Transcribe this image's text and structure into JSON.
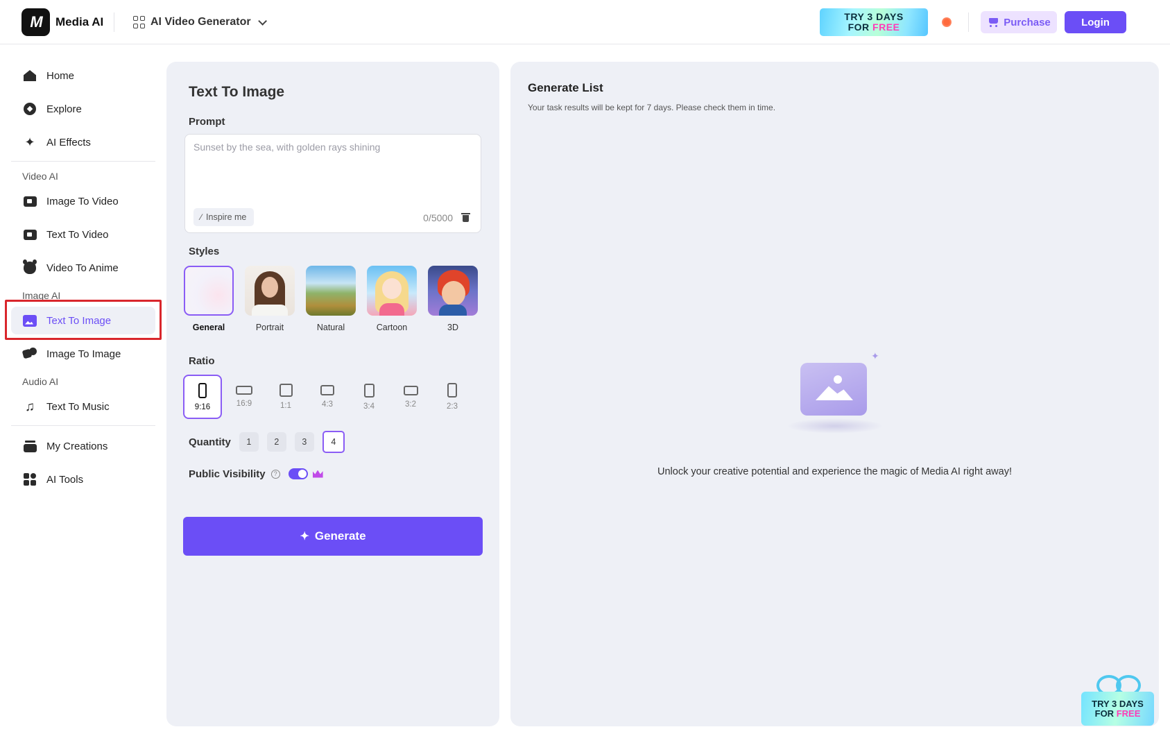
{
  "header": {
    "logo_text": "Media AI",
    "logo_mark": "M",
    "product_switch_label": "AI Video Generator",
    "promo": {
      "line1": "TRY 3 DAYS",
      "line2_prefix": "FOR ",
      "line2_highlight": "FREE"
    },
    "purchase_label": "Purchase",
    "login_label": "Login"
  },
  "sidebar": {
    "items_top": [
      {
        "label": "Home",
        "icon": "home-icon"
      },
      {
        "label": "Explore",
        "icon": "compass-icon"
      },
      {
        "label": "AI Effects",
        "icon": "sparkles-icon"
      }
    ],
    "section_video": "Video AI",
    "items_video": [
      {
        "label": "Image To Video",
        "icon": "image-video-icon"
      },
      {
        "label": "Text To Video",
        "icon": "text-video-icon"
      },
      {
        "label": "Video To Anime",
        "icon": "anime-icon"
      }
    ],
    "section_image": "Image AI",
    "items_image": [
      {
        "label": "Text To Image",
        "icon": "text-image-icon",
        "active": true
      },
      {
        "label": "Image To Image",
        "icon": "image-image-icon"
      }
    ],
    "section_audio": "Audio AI",
    "items_audio": [
      {
        "label": "Text To Music",
        "icon": "music-icon"
      }
    ],
    "items_bottom": [
      {
        "label": "My Creations",
        "icon": "creations-icon"
      },
      {
        "label": "AI Tools",
        "icon": "tools-icon"
      }
    ]
  },
  "form": {
    "title": "Text To Image",
    "prompt_label": "Prompt",
    "prompt_value": "",
    "prompt_placeholder": "Sunset by the sea, with golden rays shining",
    "inspire_label": "Inspire me",
    "char_count": "0/5000",
    "styles_label": "Styles",
    "styles": [
      {
        "name": "General",
        "selected": true
      },
      {
        "name": "Portrait",
        "selected": false
      },
      {
        "name": "Natural",
        "selected": false
      },
      {
        "name": "Cartoon",
        "selected": false
      },
      {
        "name": "3D",
        "selected": false
      }
    ],
    "ratio_label": "Ratio",
    "ratios": [
      {
        "label": "9:16",
        "selected": true
      },
      {
        "label": "16:9",
        "selected": false
      },
      {
        "label": "1:1",
        "selected": false
      },
      {
        "label": "4:3",
        "selected": false
      },
      {
        "label": "3:4",
        "selected": false
      },
      {
        "label": "3:2",
        "selected": false
      },
      {
        "label": "2:3",
        "selected": false
      }
    ],
    "quantity_label": "Quantity",
    "quantities": [
      "1",
      "2",
      "3",
      "4"
    ],
    "quantity_selected": "4",
    "visibility_label": "Public Visibility",
    "visibility_help": "?",
    "visibility_on": true,
    "generate_label": "Generate"
  },
  "generate_list": {
    "title": "Generate List",
    "subtitle": "Your task results will be kept for 7 days. Please check them in time.",
    "empty_message": "Unlock your creative potential and experience the magic of Media AI right away!"
  },
  "floating_promo": {
    "line1": "TRY 3 DAYS",
    "line2_prefix": "FOR ",
    "line2_highlight": "FREE"
  },
  "colors": {
    "accent": "#6b4ef6",
    "selection_border": "#8a5cf5",
    "panel_bg": "#eef0f6",
    "highlight_border": "#d9262c"
  }
}
